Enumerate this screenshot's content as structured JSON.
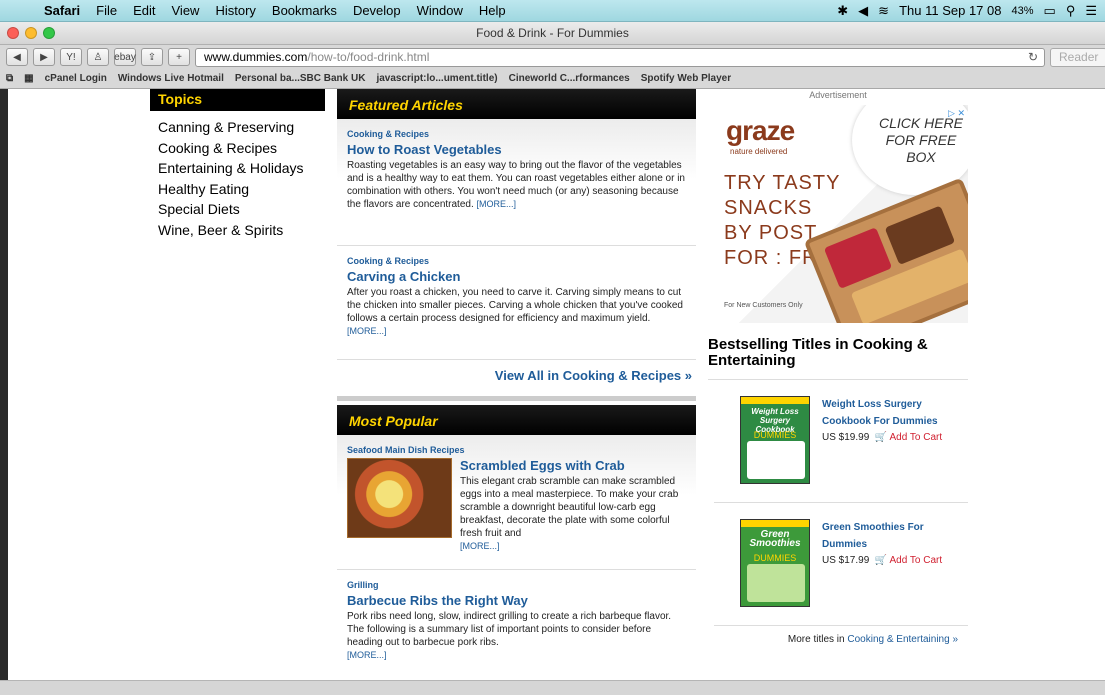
{
  "menubar": {
    "app": "Safari",
    "items": [
      "File",
      "Edit",
      "View",
      "History",
      "Bookmarks",
      "Develop",
      "Window",
      "Help"
    ],
    "clock": "Thu 11 Sep  17 08",
    "battery": "43%"
  },
  "window": {
    "title": "Food & Drink - For Dummies"
  },
  "toolbar": {
    "url_host": "www.dummies.com",
    "url_path": "/how-to/food-drink.html",
    "reader_label": "Reader"
  },
  "bookmarks": [
    "cPanel Login",
    "Windows Live Hotmail",
    "Personal ba...SBC Bank UK",
    "javascript:lo...ument.title)",
    "Cineworld C...rformances",
    "Spotify Web Player"
  ],
  "topics": {
    "heading": "Topics",
    "items": [
      "Canning & Preserving",
      "Cooking & Recipes",
      "Entertaining & Holidays",
      "Healthy Eating",
      "Special Diets",
      "Wine, Beer & Spirits"
    ]
  },
  "featured": {
    "heading": "Featured Articles",
    "articles": [
      {
        "category": "Cooking & Recipes",
        "title": "How to Roast Vegetables",
        "text": "Roasting vegetables is an easy way to bring out the flavor of the vegetables and is a healthy way to eat them. You can roast vegetables either alone or in combination with others. You won't need much (or any) seasoning because the flavors are concentrated.",
        "more": "[MORE...]"
      },
      {
        "category": "Cooking & Recipes",
        "title": "Carving a Chicken",
        "text": "After you roast a chicken, you need to carve it. Carving simply means to cut the chicken into smaller pieces. Carving a whole chicken that you've cooked follows a certain process designed for efficiency and maximum yield.",
        "more": "[MORE...]"
      }
    ],
    "view_all": "View All in Cooking & Recipes »"
  },
  "popular": {
    "heading": "Most Popular",
    "articles": [
      {
        "category": "Seafood Main Dish Recipes",
        "title": "Scrambled Eggs with Crab",
        "text": "This elegant crab scramble can make scrambled eggs into a meal masterpiece. To make your crab scramble a downright beautiful low-carb egg breakfast, decorate the plate with some colorful fresh fruit and",
        "more": "[MORE...]"
      },
      {
        "category": "Grilling",
        "title": "Barbecue Ribs the Right Way",
        "text": "Pork ribs need long, slow, indirect grilling to create a rich barbeque flavor. The following is a summary list of important points to consider before heading out to barbecue pork ribs.",
        "more": "[MORE...]"
      }
    ]
  },
  "ad": {
    "label": "Advertisement",
    "brand": "graze",
    "brand_sub": "nature delivered",
    "cta": "CLICK HERE FOR FREE BOX",
    "lines": [
      "TRY TASTY",
      "SNACKS",
      "BY POST",
      "FOR : FREE"
    ],
    "footnote": "For New Customers Only"
  },
  "bestselling": {
    "heading": "Bestselling Titles in Cooking & Entertaining",
    "books": [
      {
        "cover_title": "Weight Loss Surgery Cookbook",
        "title": "Weight Loss Surgery Cookbook For Dummies",
        "price": "US $19.99",
        "cart": "Add To Cart"
      },
      {
        "cover_title": "Green Smoothies",
        "title": "Green Smoothies For Dummies",
        "price": "US $17.99",
        "cart": "Add To Cart"
      }
    ],
    "more_prefix": "More titles in ",
    "more_link": "Cooking & Entertaining »"
  },
  "colors": {
    "link": "#1f5c99",
    "heading_bg": "#000000",
    "heading_text": "#ffd400",
    "cart": "#d01f2f"
  }
}
